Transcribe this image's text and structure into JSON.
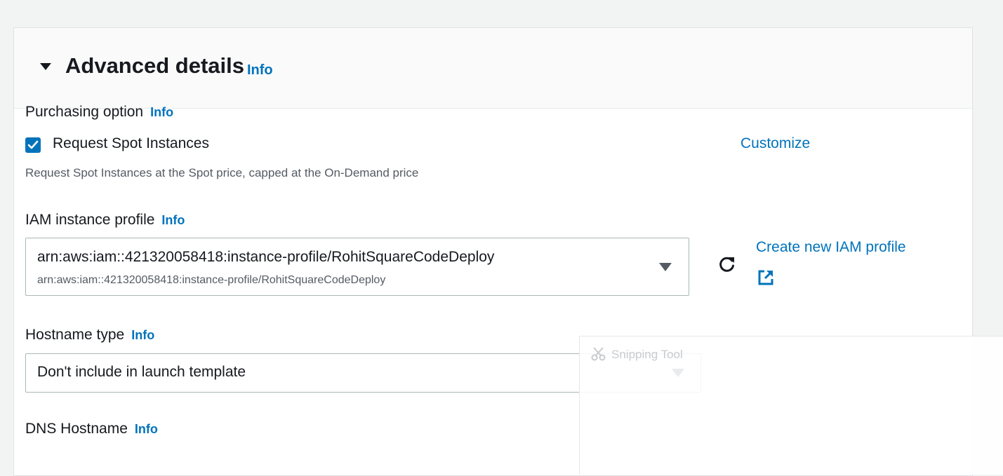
{
  "section": {
    "title": "Advanced details",
    "info": "Info"
  },
  "purchasing": {
    "label": "Purchasing option",
    "info": "Info",
    "checkbox_label": "Request Spot Instances",
    "checked": true,
    "customize": "Customize",
    "description": "Request Spot Instances at the Spot price, capped at the On-Demand price"
  },
  "iam": {
    "label": "IAM instance profile",
    "info": "Info",
    "selected": "arn:aws:iam::421320058418:instance-profile/RohitSquareCodeDeploy",
    "selected_sub": "arn:aws:iam::421320058418:instance-profile/RohitSquareCodeDeploy",
    "create_link": "Create new IAM profile",
    "refresh_icon": "refresh-icon",
    "external_icon": "external-link-icon"
  },
  "hostname": {
    "label": "Hostname type",
    "info": "Info",
    "selected": "Don't include in launch template"
  },
  "dns": {
    "label": "DNS Hostname",
    "info": "Info"
  },
  "overlay": {
    "text": "Snipping Tool",
    "icon": "scissors-icon"
  },
  "colors": {
    "link": "#0073bb",
    "checkbox": "#0073bb",
    "text": "#16191f",
    "secondary_text": "#545b64",
    "header_bg": "#fafafa",
    "page_bg": "#f2f3f3"
  }
}
